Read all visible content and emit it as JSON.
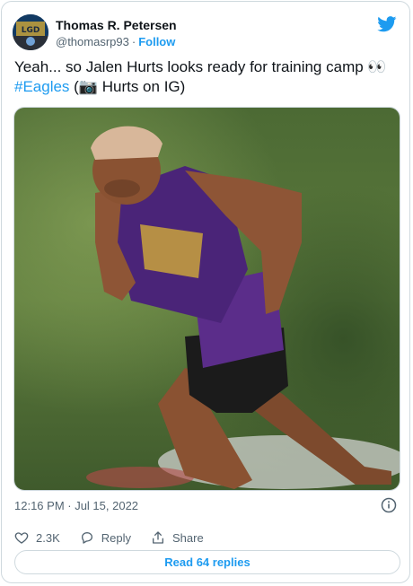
{
  "author": {
    "name": "Thomas R. Petersen",
    "handle": "@thomasrp93",
    "separator": "·",
    "follow_label": "Follow"
  },
  "tweet": {
    "text_prefix": "Yeah... so Jalen Hurts looks ready for training camp ",
    "eyes_emoji": "👀",
    "hashtag": "#Eagles",
    "paren_open": " (",
    "camera_emoji": "📷",
    "text_suffix": " Hurts on IG)"
  },
  "meta": {
    "timestamp": "12:16 PM · Jul 15, 2022"
  },
  "actions": {
    "like_count": "2.3K",
    "reply_label": "Reply",
    "share_label": "Share"
  },
  "read_replies_label": "Read 64 replies",
  "colors": {
    "accent": "#1d9bf0",
    "muted": "#536471",
    "text": "#0f1419",
    "border": "#cfd9de"
  },
  "icons": {
    "brand": "twitter-bird-icon",
    "info": "info-icon",
    "like": "heart-icon",
    "reply": "reply-bubble-icon",
    "share": "share-icon"
  }
}
